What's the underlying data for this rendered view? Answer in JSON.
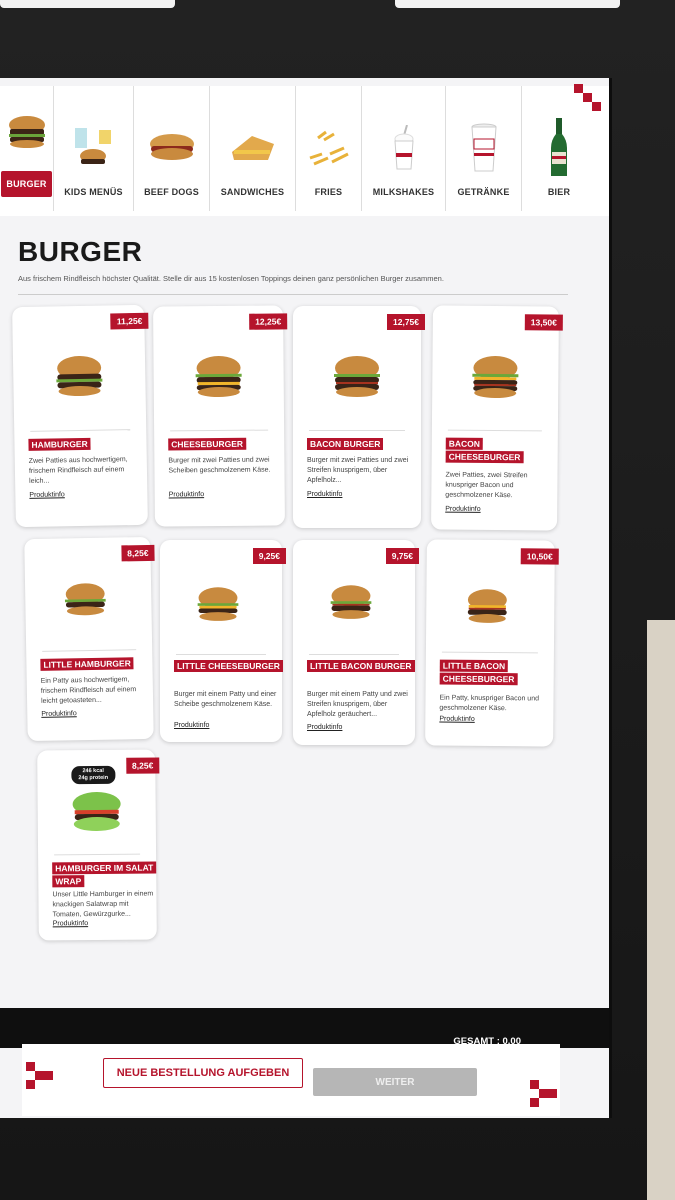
{
  "categories": [
    {
      "label": "BURGER",
      "icon": "burger-icon",
      "active": true
    },
    {
      "label": "KIDS MENÜS",
      "icon": "kids-menu-icon",
      "active": false
    },
    {
      "label": "BEEF DOGS",
      "icon": "hotdog-icon",
      "active": false
    },
    {
      "label": "SANDWICHES",
      "icon": "sandwich-icon",
      "active": false
    },
    {
      "label": "FRIES",
      "icon": "fries-icon",
      "active": false
    },
    {
      "label": "MILKSHAKES",
      "icon": "milkshake-icon",
      "active": false
    },
    {
      "label": "GETRÄNKE",
      "icon": "drink-cup-icon",
      "active": false
    },
    {
      "label": "BIER",
      "icon": "beer-bottle-icon",
      "active": false
    }
  ],
  "page": {
    "title": "BURGER",
    "subtitle": "Aus frischem Rindfleisch höchster Qualität. Stelle dir aus 15 kostenlosen Toppings deinen ganz persönlichen Burger zusammen."
  },
  "products": [
    {
      "name": "HAMBURGER",
      "price": "11,25€",
      "desc": "Zwei Patties aus hochwertigem, frischem Rindfleisch auf einem leich...",
      "info": "Produktinfo"
    },
    {
      "name": "CHEESEBURGER",
      "price": "12,25€",
      "desc": "Burger mit zwei Patties und zwei Scheiben geschmolzenem Käse.",
      "info": "Produktinfo"
    },
    {
      "name": "BACON BURGER",
      "price": "12,75€",
      "desc": "Burger mit zwei Patties und zwei Streifen knusprigem, über Apfelholz...",
      "info": "Produktinfo"
    },
    {
      "name": "BACON CHEESEBURGER",
      "price": "13,50€",
      "desc": "Zwei Patties, zwei Streifen knuspriger Bacon und geschmolzener Käse.",
      "info": "Produktinfo"
    },
    {
      "name": "LITTLE HAMBURGER",
      "price": "8,25€",
      "desc": "Ein Patty aus hochwertigem, frischem Rindfleisch auf einem leicht getoasteten...",
      "info": "Produktinfo"
    },
    {
      "name": "LITTLE CHEESEBURGER",
      "price": "9,25€",
      "desc": "Burger mit einem Patty und einer Scheibe geschmolzenem Käse.",
      "info": "Produktinfo"
    },
    {
      "name": "LITTLE BACON BURGER",
      "price": "9,75€",
      "desc": "Burger mit einem Patty und zwei Streifen knusprigem, über Apfelholz geräuchert...",
      "info": "Produktinfo"
    },
    {
      "name": "LITTLE BACON CHEESEBURGER",
      "price": "10,50€",
      "desc": "Ein Patty, knuspriger Bacon und geschmolzener Käse.",
      "info": "Produktinfo"
    },
    {
      "name": "HAMBURGER IM SALAT WRAP",
      "price": "8,25€",
      "desc": "Unser Little Hamburger in einem knackigen Salatwrap mit Tomaten, Gewürzgurke...",
      "info": "Produktinfo",
      "badge_line1": "246 kcal",
      "badge_line2": "24g protein"
    }
  ],
  "footer": {
    "total": "GESAMT : 0.00",
    "new_order": "NEUE BESTELLUNG AUFGEBEN",
    "next": "WEITER"
  },
  "colors": {
    "accent": "#b5142c",
    "button_disabled": "#b6b6b6"
  }
}
